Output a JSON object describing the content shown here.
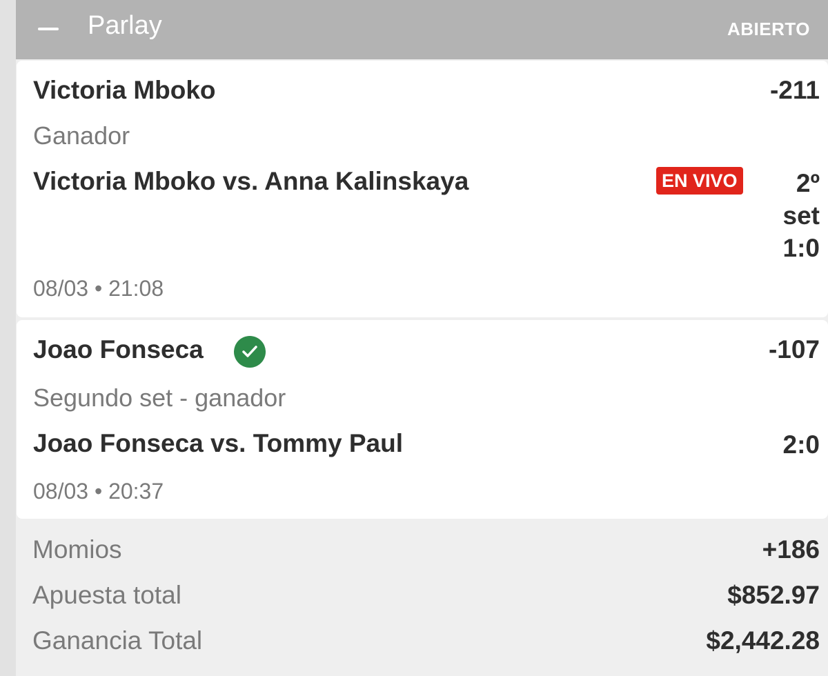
{
  "header": {
    "title": "Parlay",
    "status": "ABIERTO",
    "collapse_icon": "minus-icon"
  },
  "selections": [
    {
      "name": "Victoria Mboko",
      "odds": "-211",
      "market": "Ganador",
      "event": "Victoria Mboko vs. Anna Kalinskaya",
      "live_badge": "EN VIVO",
      "period": "2º set",
      "score": "1:0",
      "datetime": "08/03 • 21:08"
    },
    {
      "name": "Joao Fonseca",
      "won_icon": "check-circle-icon",
      "odds": "-107",
      "market": "Segundo set - ganador",
      "event": "Joao Fonseca vs. Tommy Paul",
      "score": "2:0",
      "datetime": "08/03 • 20:37"
    }
  ],
  "summary": {
    "odds_label": "Momios",
    "odds_value": "+186",
    "stake_label": "Apuesta total",
    "stake_value": "$852.97",
    "payout_label": "Ganancia Total",
    "payout_value": "$2,442.28"
  },
  "colors": {
    "header_bg": "#b3b3b3",
    "live_badge": "#e1251b",
    "check": "#2e8b4a"
  }
}
